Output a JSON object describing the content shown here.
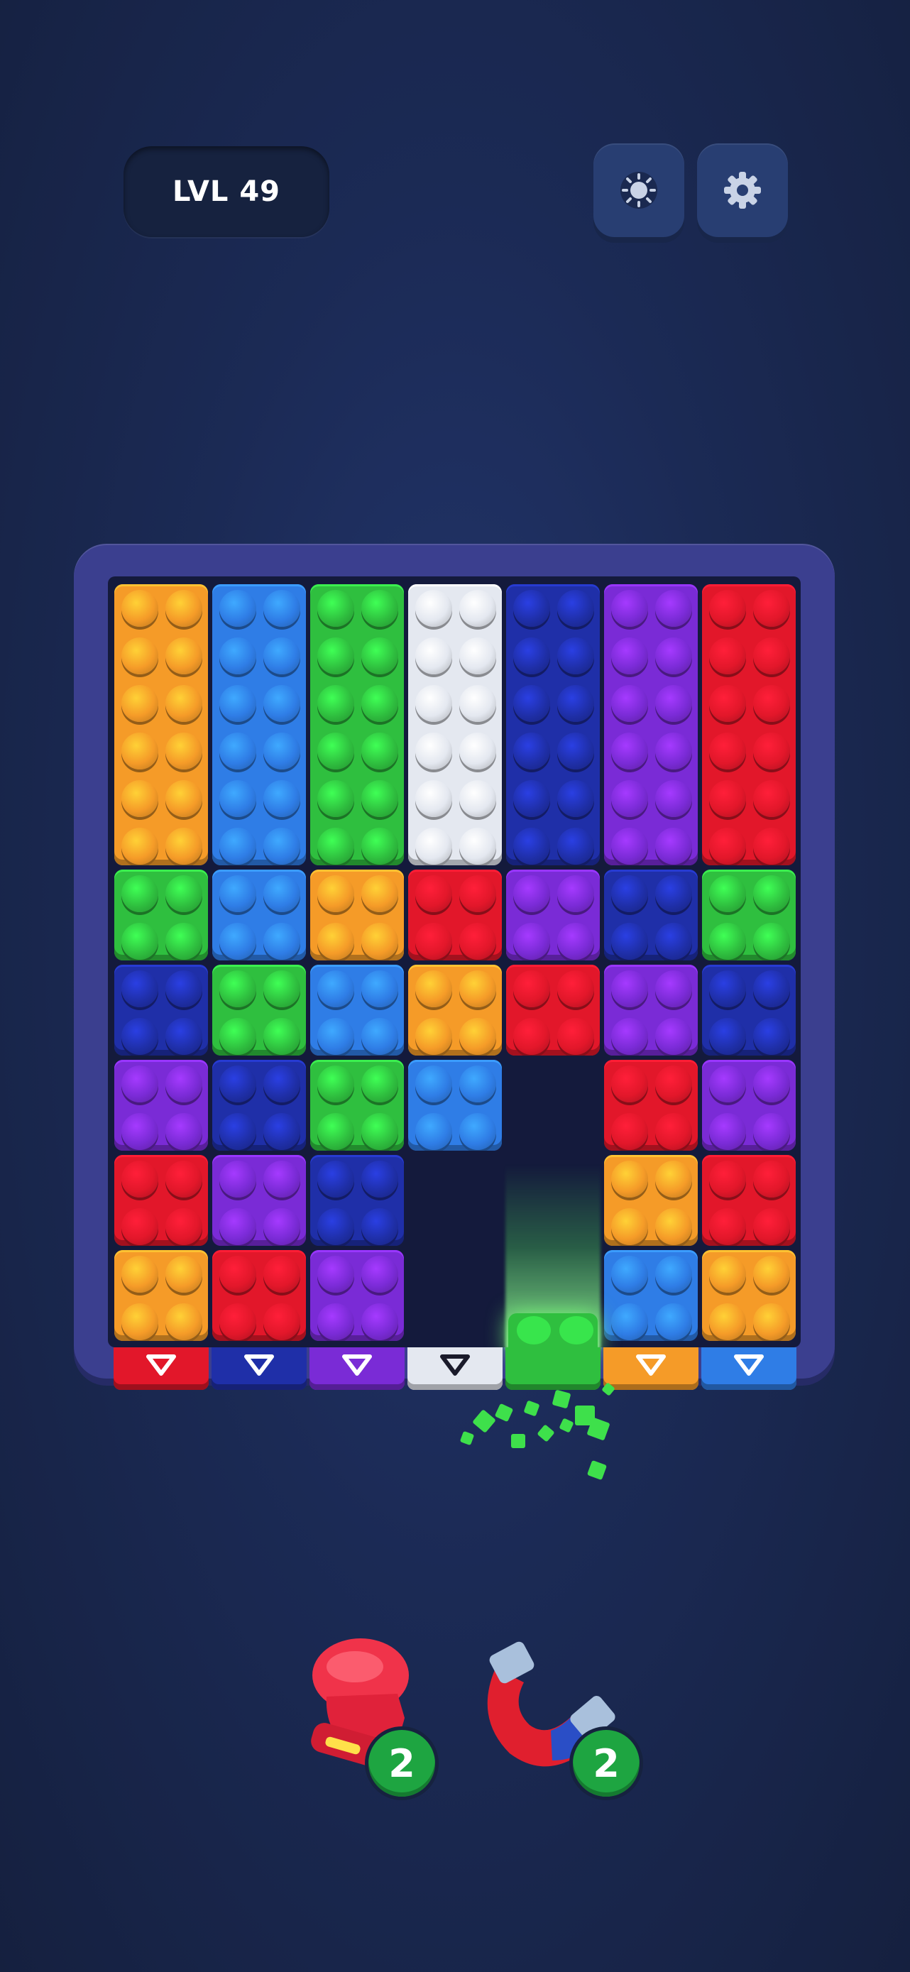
{
  "hud": {
    "level_label": "LVL 49",
    "theme_icon": "sun-icon",
    "settings_icon": "gear-icon"
  },
  "colors": {
    "orange": "#f59b28",
    "blue": "#2f7de6",
    "green": "#2fbf3f",
    "white": "#e4e8f0",
    "navy": "#1f2fa8",
    "purple": "#7a2bd6",
    "red": "#e2172a"
  },
  "board": {
    "columns": 7,
    "rows": 9,
    "blocks": [
      {
        "col": 0,
        "row": 0,
        "h": 3,
        "color": "orange"
      },
      {
        "col": 1,
        "row": 0,
        "h": 3,
        "color": "blue"
      },
      {
        "col": 2,
        "row": 0,
        "h": 3,
        "color": "green"
      },
      {
        "col": 3,
        "row": 0,
        "h": 3,
        "color": "white"
      },
      {
        "col": 4,
        "row": 0,
        "h": 3,
        "color": "navy"
      },
      {
        "col": 5,
        "row": 0,
        "h": 3,
        "color": "purple"
      },
      {
        "col": 6,
        "row": 0,
        "h": 3,
        "color": "red"
      },
      {
        "col": 0,
        "row": 3,
        "h": 1,
        "color": "green"
      },
      {
        "col": 1,
        "row": 3,
        "h": 1,
        "color": "blue"
      },
      {
        "col": 2,
        "row": 3,
        "h": 1,
        "color": "orange"
      },
      {
        "col": 3,
        "row": 3,
        "h": 1,
        "color": "red"
      },
      {
        "col": 4,
        "row": 3,
        "h": 1,
        "color": "purple"
      },
      {
        "col": 5,
        "row": 3,
        "h": 1,
        "color": "navy"
      },
      {
        "col": 6,
        "row": 3,
        "h": 1,
        "color": "green"
      },
      {
        "col": 0,
        "row": 4,
        "h": 1,
        "color": "navy"
      },
      {
        "col": 1,
        "row": 4,
        "h": 1,
        "color": "green"
      },
      {
        "col": 2,
        "row": 4,
        "h": 1,
        "color": "blue"
      },
      {
        "col": 3,
        "row": 4,
        "h": 1,
        "color": "orange"
      },
      {
        "col": 4,
        "row": 4,
        "h": 1,
        "color": "red"
      },
      {
        "col": 5,
        "row": 4,
        "h": 1,
        "color": "purple"
      },
      {
        "col": 6,
        "row": 4,
        "h": 1,
        "color": "navy"
      },
      {
        "col": 0,
        "row": 5,
        "h": 1,
        "color": "purple"
      },
      {
        "col": 1,
        "row": 5,
        "h": 1,
        "color": "navy"
      },
      {
        "col": 2,
        "row": 5,
        "h": 1,
        "color": "green"
      },
      {
        "col": 3,
        "row": 5,
        "h": 1,
        "color": "blue"
      },
      {
        "col": 5,
        "row": 5,
        "h": 1,
        "color": "red"
      },
      {
        "col": 6,
        "row": 5,
        "h": 1,
        "color": "purple"
      },
      {
        "col": 0,
        "row": 6,
        "h": 1,
        "color": "red"
      },
      {
        "col": 1,
        "row": 6,
        "h": 1,
        "color": "purple"
      },
      {
        "col": 2,
        "row": 6,
        "h": 1,
        "color": "navy"
      },
      {
        "col": 5,
        "row": 6,
        "h": 1,
        "color": "orange"
      },
      {
        "col": 6,
        "row": 6,
        "h": 1,
        "color": "red"
      },
      {
        "col": 0,
        "row": 7,
        "h": 1,
        "color": "orange"
      },
      {
        "col": 1,
        "row": 7,
        "h": 1,
        "color": "red"
      },
      {
        "col": 2,
        "row": 7,
        "h": 1,
        "color": "purple"
      },
      {
        "col": 5,
        "row": 7,
        "h": 1,
        "color": "blue"
      },
      {
        "col": 6,
        "row": 7,
        "h": 1,
        "color": "orange"
      }
    ],
    "exits": [
      "red",
      "navy",
      "purple",
      "white",
      "green",
      "orange",
      "blue"
    ],
    "exiting_block": {
      "col": 4,
      "color": "green"
    }
  },
  "boosters": [
    {
      "name": "boxing-glove",
      "icon": "boxing-glove-icon",
      "count": "2"
    },
    {
      "name": "magnet",
      "icon": "magnet-icon",
      "count": "2"
    }
  ]
}
